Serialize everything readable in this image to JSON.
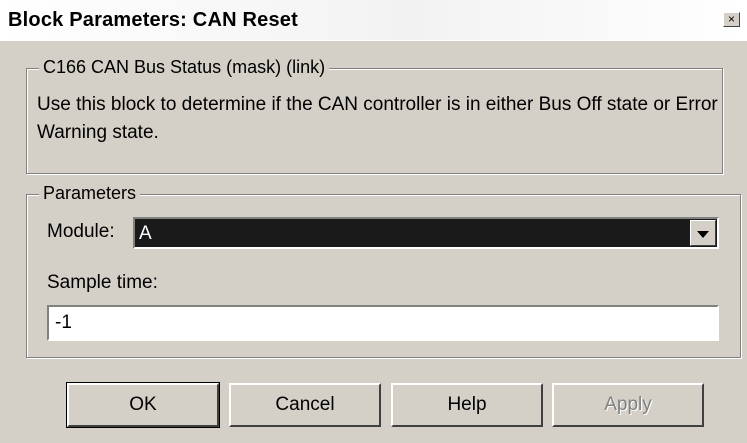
{
  "window": {
    "title": "Block Parameters: CAN Reset",
    "close_glyph": "×"
  },
  "description_group": {
    "legend": "C166 CAN Bus Status (mask) (link)",
    "text": "Use this block to determine if the CAN controller is in either Bus Off state or Error Warning state."
  },
  "parameters_group": {
    "legend": "Parameters",
    "module_label": "Module:",
    "module_value": "A",
    "sample_time_label": "Sample time:",
    "sample_time_value": "-1"
  },
  "buttons": {
    "ok": "OK",
    "cancel": "Cancel",
    "help": "Help",
    "apply": "Apply"
  }
}
